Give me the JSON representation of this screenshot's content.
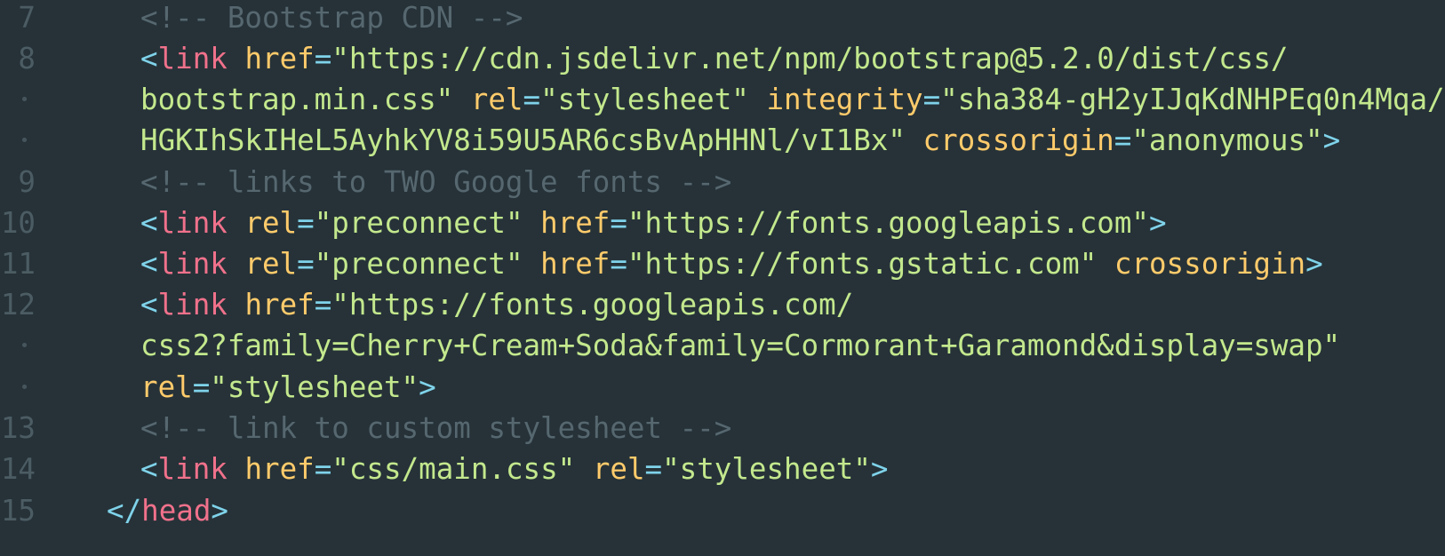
{
  "editor": {
    "colors": {
      "background": "#263238",
      "gutter": "#4c5c63",
      "comment": "#56676f",
      "punctuation": "#7fd3ea",
      "tag": "#f0718b",
      "attribute": "#ffcb6b",
      "string": "#c3e88d"
    },
    "wrap_marker": "•",
    "lines": [
      {
        "gutter": "7",
        "segments": [
          {
            "t": "<!-- Bootstrap CDN -->",
            "c": "comment"
          }
        ]
      },
      {
        "gutter": "8",
        "segments": [
          {
            "t": "<",
            "c": "punct"
          },
          {
            "t": "link",
            "c": "tag"
          },
          {
            "t": " ",
            "c": "plain"
          },
          {
            "t": "href",
            "c": "attr"
          },
          {
            "t": "=",
            "c": "punct"
          },
          {
            "t": "\"https://cdn.jsdelivr.net/npm/bootstrap@5.2.0/dist/css/",
            "c": "str"
          }
        ]
      },
      {
        "gutter": "•",
        "segments": [
          {
            "t": "bootstrap.min.css\"",
            "c": "str"
          },
          {
            "t": " ",
            "c": "plain"
          },
          {
            "t": "rel",
            "c": "attr"
          },
          {
            "t": "=",
            "c": "punct"
          },
          {
            "t": "\"stylesheet\"",
            "c": "str"
          },
          {
            "t": " ",
            "c": "plain"
          },
          {
            "t": "integrity",
            "c": "attr"
          },
          {
            "t": "=",
            "c": "punct"
          },
          {
            "t": "\"sha384-gH2yIJqKdNHPEq0n4Mqa/",
            "c": "str"
          }
        ]
      },
      {
        "gutter": "•",
        "segments": [
          {
            "t": "HGKIhSkIHeL5AyhkYV8i59U5AR6csBvApHHNl/vI1Bx\"",
            "c": "str"
          },
          {
            "t": " ",
            "c": "plain"
          },
          {
            "t": "crossorigin",
            "c": "attr"
          },
          {
            "t": "=",
            "c": "punct"
          },
          {
            "t": "\"anonymous\"",
            "c": "str"
          },
          {
            "t": ">",
            "c": "punct"
          }
        ]
      },
      {
        "gutter": "9",
        "segments": [
          {
            "t": "<!-- links to TWO Google fonts -->",
            "c": "comment"
          }
        ]
      },
      {
        "gutter": "10",
        "segments": [
          {
            "t": "<",
            "c": "punct"
          },
          {
            "t": "link",
            "c": "tag"
          },
          {
            "t": " ",
            "c": "plain"
          },
          {
            "t": "rel",
            "c": "attr"
          },
          {
            "t": "=",
            "c": "punct"
          },
          {
            "t": "\"preconnect\"",
            "c": "str"
          },
          {
            "t": " ",
            "c": "plain"
          },
          {
            "t": "href",
            "c": "attr"
          },
          {
            "t": "=",
            "c": "punct"
          },
          {
            "t": "\"https://fonts.googleapis.com\"",
            "c": "str"
          },
          {
            "t": ">",
            "c": "punct"
          }
        ]
      },
      {
        "gutter": "11",
        "segments": [
          {
            "t": "<",
            "c": "punct"
          },
          {
            "t": "link",
            "c": "tag"
          },
          {
            "t": " ",
            "c": "plain"
          },
          {
            "t": "rel",
            "c": "attr"
          },
          {
            "t": "=",
            "c": "punct"
          },
          {
            "t": "\"preconnect\"",
            "c": "str"
          },
          {
            "t": " ",
            "c": "plain"
          },
          {
            "t": "href",
            "c": "attr"
          },
          {
            "t": "=",
            "c": "punct"
          },
          {
            "t": "\"https://fonts.gstatic.com\"",
            "c": "str"
          },
          {
            "t": " ",
            "c": "plain"
          },
          {
            "t": "crossorigin",
            "c": "attr"
          },
          {
            "t": ">",
            "c": "punct"
          }
        ]
      },
      {
        "gutter": "12",
        "segments": [
          {
            "t": "<",
            "c": "punct"
          },
          {
            "t": "link",
            "c": "tag"
          },
          {
            "t": " ",
            "c": "plain"
          },
          {
            "t": "href",
            "c": "attr"
          },
          {
            "t": "=",
            "c": "punct"
          },
          {
            "t": "\"https://fonts.googleapis.com/",
            "c": "str"
          }
        ]
      },
      {
        "gutter": "•",
        "segments": [
          {
            "t": "css2?family=Cherry+Cream+Soda&family=Cormorant+Garamond&display=swap\"",
            "c": "str"
          }
        ]
      },
      {
        "gutter": "•",
        "segments": [
          {
            "t": "rel",
            "c": "attr"
          },
          {
            "t": "=",
            "c": "punct"
          },
          {
            "t": "\"stylesheet\"",
            "c": "str"
          },
          {
            "t": ">",
            "c": "punct"
          }
        ]
      },
      {
        "gutter": "13",
        "segments": [
          {
            "t": "<!-- link to custom stylesheet -->",
            "c": "comment"
          }
        ]
      },
      {
        "gutter": "14",
        "segments": [
          {
            "t": "<",
            "c": "punct"
          },
          {
            "t": "link",
            "c": "tag"
          },
          {
            "t": " ",
            "c": "plain"
          },
          {
            "t": "href",
            "c": "attr"
          },
          {
            "t": "=",
            "c": "punct"
          },
          {
            "t": "\"css/main.css\"",
            "c": "str"
          },
          {
            "t": " ",
            "c": "plain"
          },
          {
            "t": "rel",
            "c": "attr"
          },
          {
            "t": "=",
            "c": "punct"
          },
          {
            "t": "\"stylesheet\"",
            "c": "str"
          },
          {
            "t": ">",
            "c": "punct"
          }
        ]
      },
      {
        "gutter": "15",
        "segments": [
          {
            "t": "</",
            "c": "punct"
          },
          {
            "t": "head",
            "c": "tag"
          },
          {
            "t": ">",
            "c": "punct"
          }
        ]
      }
    ]
  }
}
